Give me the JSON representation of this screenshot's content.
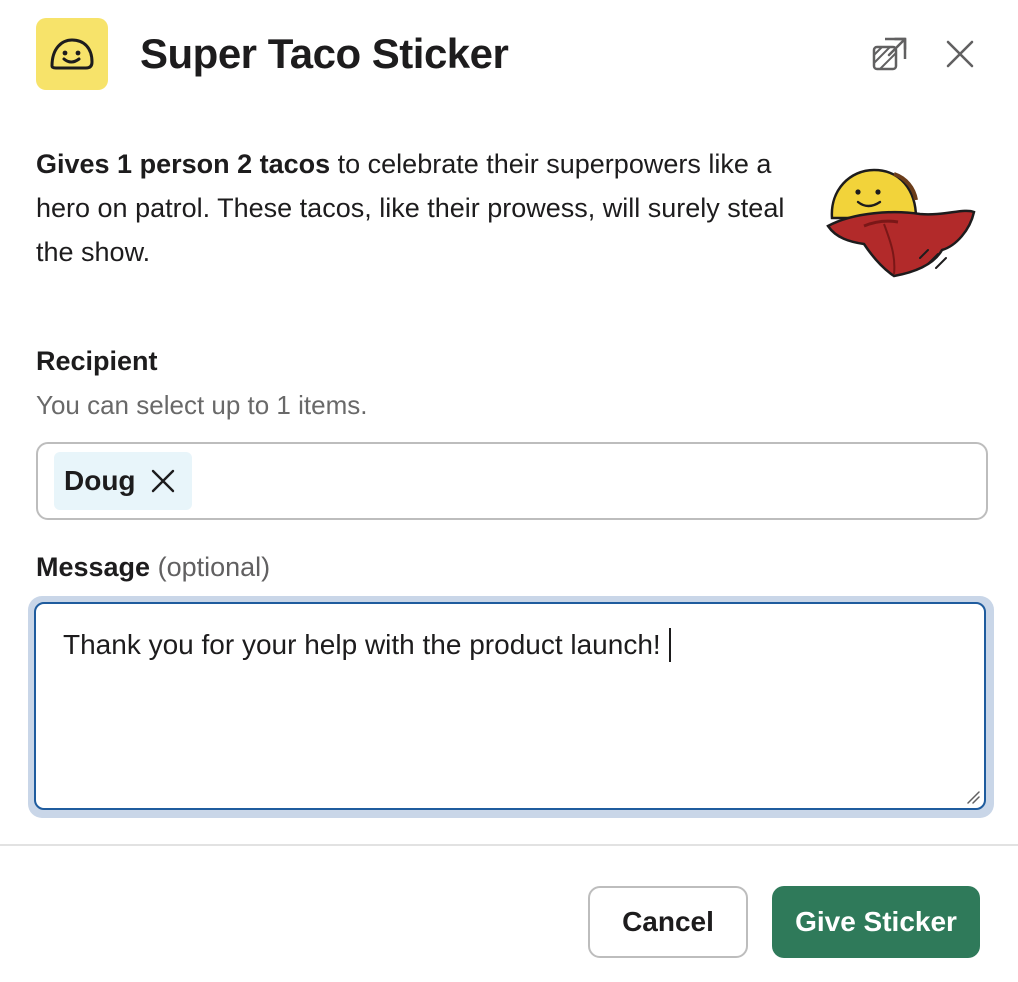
{
  "header": {
    "title": "Super Taco Sticker",
    "app_icon": "taco-face-icon",
    "popout_icon": "open-in-new-window-icon",
    "close_icon": "close-icon"
  },
  "description": {
    "bold": "Gives 1 person 2 tacos",
    "rest": " to celebrate their superpowers like a hero on patrol. These tacos, like their prowess, will surely steal the show.",
    "image": "superhero-taco-with-cape"
  },
  "recipient": {
    "label": "Recipient",
    "hint": "You can select up to 1 items.",
    "selected": [
      "Doug"
    ]
  },
  "message": {
    "label": "Message",
    "optional": "(optional)",
    "value": "Thank you for your help with the product launch!"
  },
  "footer": {
    "cancel_label": "Cancel",
    "submit_label": "Give Sticker"
  },
  "colors": {
    "accent": "#2f7a5a",
    "icon_bg": "#f7e36a",
    "focus_border": "#1f5c9e",
    "chip_bg": "#e8f5fa"
  }
}
